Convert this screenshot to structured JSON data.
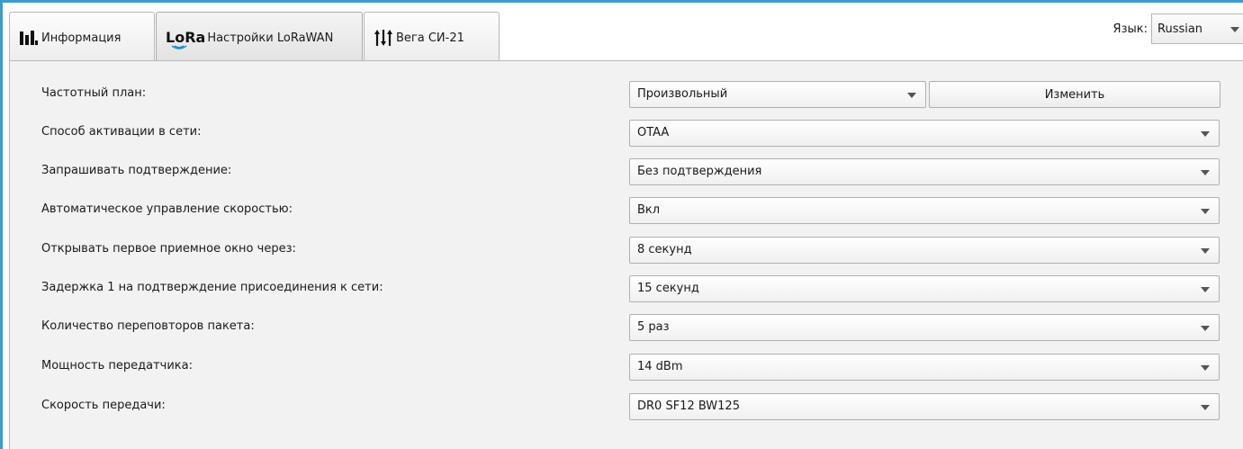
{
  "tabs": [
    {
      "label": "Информация",
      "icon": "bar-chart-icon"
    },
    {
      "label": "Настройки LoRaWAN",
      "icon": "lora-logo-icon",
      "logo_text": "LoRa"
    },
    {
      "label": "Вега СИ-21",
      "icon": "sliders-icon"
    }
  ],
  "active_tab": 1,
  "language": {
    "label": "Язык:",
    "value": "Russian"
  },
  "settings": {
    "rows": [
      {
        "label": "Частотный план:",
        "value": "Произвольный"
      },
      {
        "label": "Способ активации в сети:",
        "value": "OTAA"
      },
      {
        "label": "Запрашивать подтверждение:",
        "value": "Без подтверждения"
      },
      {
        "label": "Автоматическое управление скоростью:",
        "value": "Вкл"
      },
      {
        "label": "Открывать первое приемное окно через:",
        "value": "8 секунд"
      },
      {
        "label": "Задержка 1 на подтверждение присоединения к сети:",
        "value": "15 секунд"
      },
      {
        "label": "Количество переповторов пакета:",
        "value": "5 раз"
      },
      {
        "label": "Мощность передатчика:",
        "value": "14 dBm"
      },
      {
        "label": "Скорость передачи:",
        "value": "DR0 SF12 BW125"
      }
    ],
    "change_button": "Изменить"
  },
  "colors": {
    "accent": "#3d9ad1",
    "lora_blue": "#1b8fd1",
    "panel_bg": "#f2f2f2"
  }
}
